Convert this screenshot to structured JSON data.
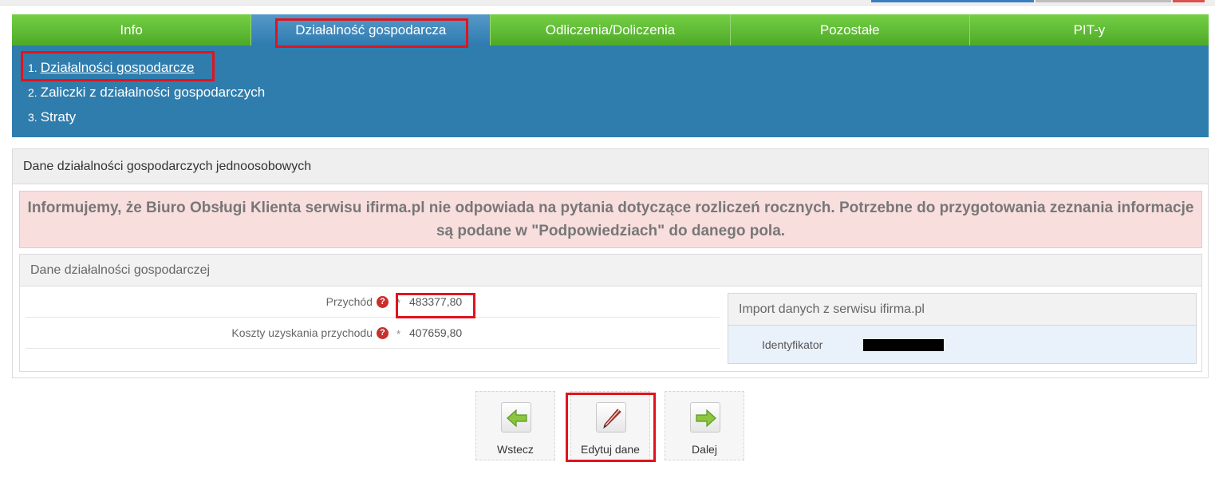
{
  "tabs": [
    {
      "label": "Info",
      "active": false
    },
    {
      "label": "Działalność gospodarcza",
      "active": true
    },
    {
      "label": "Odliczenia/Doliczenia",
      "active": false
    },
    {
      "label": "Pozostałe",
      "active": false
    },
    {
      "label": "PIT-y",
      "active": false
    }
  ],
  "subnav": [
    {
      "num": "1.",
      "label": "Działalności gospodarcze"
    },
    {
      "num": "2.",
      "label": "Zaliczki z działalności gospodarczych"
    },
    {
      "num": "3.",
      "label": "Straty"
    }
  ],
  "panel": {
    "title": "Dane działalności gospodarczych jednoosobowych",
    "alert": "Informujemy, że Biuro Obsługi Klienta serwisu ifirma.pl nie odpowiada na pytania dotyczące rozliczeń rocznych. Potrzebne do przygotowania zeznania informacje są podane w \"Podpowiedziach\" do danego pola.",
    "section_title": "Dane działalności gospodarczej",
    "fields": [
      {
        "label": "Przychód",
        "help": "?",
        "required": "*",
        "value": "483377,80"
      },
      {
        "label": "Koszty uzyskania przychodu",
        "help": "?",
        "required": "*",
        "value": "407659,80"
      }
    ],
    "import": {
      "title": "Import danych z serwisu ifirma.pl",
      "id_label": "Identyfikator"
    }
  },
  "buttons": {
    "back": "Wstecz",
    "edit": "Edytuj dane",
    "next": "Dalej"
  },
  "colors": {
    "tab_green": "#5cb935",
    "tab_active": "#3a86bb",
    "subnav_blue": "#2f7dad",
    "alert_bg": "#f9dede",
    "highlight": "#e0141e"
  }
}
